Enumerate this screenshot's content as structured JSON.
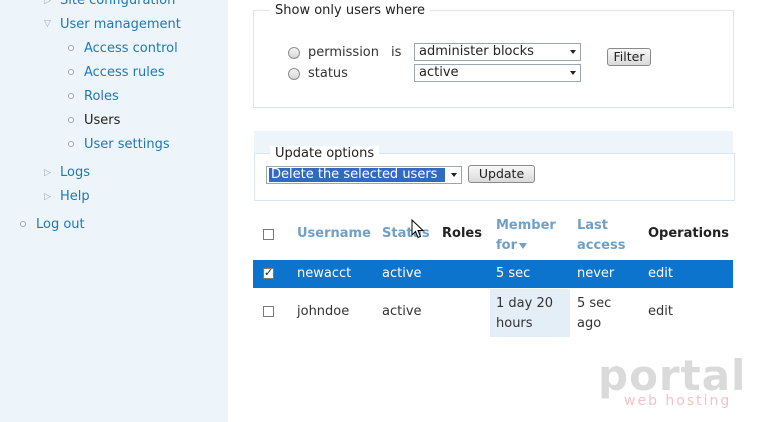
{
  "sidebar": {
    "site_configuration": "Site configuration",
    "user_management": "User management",
    "access_control": "Access control",
    "access_rules": "Access rules",
    "roles": "Roles",
    "users": "Users",
    "user_settings": "User settings",
    "logs": "Logs",
    "help": "Help",
    "log_out": "Log out"
  },
  "filter": {
    "legend": "Show only users where",
    "permission_label": "permission",
    "status_label": "status",
    "is_label": "is",
    "permission_value": "administer blocks",
    "status_value": "active",
    "filter_button": "Filter"
  },
  "update": {
    "legend": "Update options",
    "operation_value": "Delete the selected users",
    "update_button": "Update"
  },
  "table": {
    "headers": {
      "username": "Username",
      "status": "Status",
      "roles": "Roles",
      "member_for_line1": "Member",
      "member_for_line2": "for",
      "last_access_line1": "Last",
      "last_access_line2": "access",
      "operations": "Operations"
    },
    "rows": [
      {
        "checked": true,
        "username": "newacct",
        "status": "active",
        "roles": "",
        "member_for": "5 sec",
        "member_for_line2": "",
        "last_access": "never",
        "last_access_line2": "",
        "operation": "edit"
      },
      {
        "checked": false,
        "username": "johndoe",
        "status": "active",
        "roles": "",
        "member_for": "1 day 20",
        "member_for_line2": "hours",
        "last_access": "5 sec",
        "last_access_line2": "ago",
        "operation": "edit"
      }
    ]
  },
  "watermark": {
    "brand": "portal",
    "tagline": "web hosting"
  },
  "colors": {
    "sidebar_bg": "#edf5fa",
    "link": "#1e78b4",
    "selected_row": "#0c74cc",
    "sorted_column": "#e4eef6"
  }
}
